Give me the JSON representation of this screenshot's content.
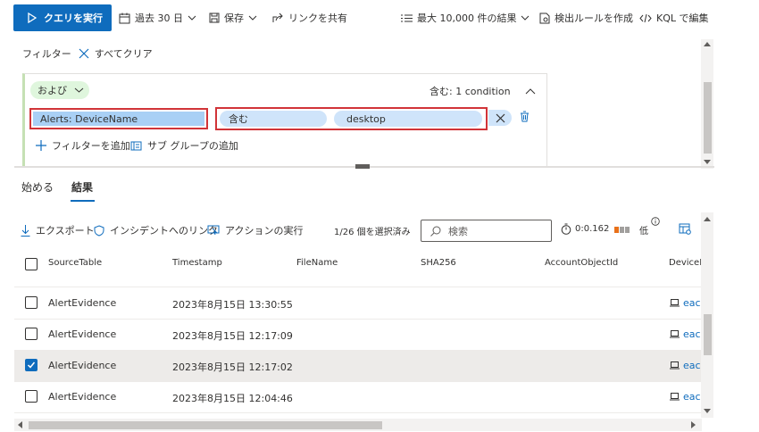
{
  "toolbar": {
    "run_query": "クエリを実行",
    "time_range": "過去 30 日",
    "save": "保存",
    "share_link": "リンクを共有",
    "max_results": "最大 10,000 件の結果",
    "create_detection_rule": "検出ルールを作成",
    "kql_edit": "KQL で編集"
  },
  "filter": {
    "label": "フィルター",
    "clear_all": "すべてクリア",
    "group_operator": "および",
    "condition_summary": "含む: 1 condition",
    "field": "Alerts: DeviceName",
    "operator": "含む",
    "value": "desktop",
    "add_filter": "フィルターを追加",
    "add_subgroup": "サブ グループの追加"
  },
  "tabs": [
    {
      "label": "始める",
      "active": false
    },
    {
      "label": "結果",
      "active": true
    }
  ],
  "results_toolbar": {
    "export": "エクスポート",
    "link_incident": "インシデントへのリンク",
    "take_action": "アクションの実行",
    "selection_count": "1/26 個を選択済み",
    "search_placeholder": "検索",
    "elapsed": "0:0.162",
    "perf_label": "低"
  },
  "table": {
    "columns": [
      "SourceTable",
      "Timestamp",
      "FileName",
      "SHA256",
      "AccountObjectId",
      "DeviceI"
    ],
    "rows": [
      {
        "checked": false,
        "source": "AlertEvidence",
        "timestamp": "2023年8月15日 13:30:55",
        "device": "eac"
      },
      {
        "checked": false,
        "source": "AlertEvidence",
        "timestamp": "2023年8月15日 12:17:09",
        "device": "eac"
      },
      {
        "checked": true,
        "source": "AlertEvidence",
        "timestamp": "2023年8月15日 12:17:02",
        "device": "eac"
      },
      {
        "checked": false,
        "source": "AlertEvidence",
        "timestamp": "2023年8月15日 12:04:46",
        "device": "eac"
      }
    ]
  },
  "colors": {
    "accent": "#0f6cbd",
    "highlight_border": "#d13438",
    "and_chip": "#dff6dd",
    "field_fill": "#a9d0f5",
    "pill_fill": "#cfe4fa",
    "perf_orange": "#e8711a"
  }
}
